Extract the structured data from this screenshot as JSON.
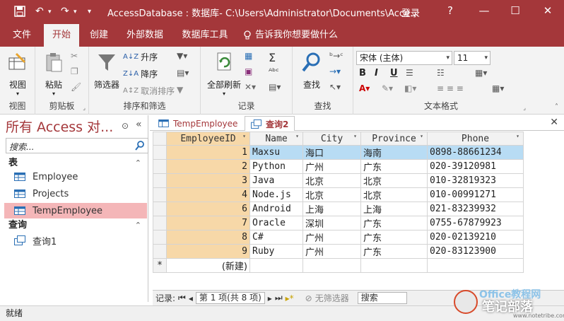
{
  "titlebar": {
    "title": "AccessDatabase : 数据库- C:\\Users\\Administrator\\Documents\\Acce...",
    "login": "登录",
    "help": "?",
    "minimize": "—",
    "restore": "☐",
    "close": "✕"
  },
  "ribbon_tabs": [
    {
      "label": "文件"
    },
    {
      "label": "开始"
    },
    {
      "label": "创建"
    },
    {
      "label": "外部数据"
    },
    {
      "label": "数据库工具"
    },
    {
      "label": "告诉我你想要做什么"
    }
  ],
  "ribbon": {
    "view": {
      "button": "视图",
      "group": "视图"
    },
    "clipboard": {
      "paste": "粘贴",
      "group": "剪贴板"
    },
    "sort_filter": {
      "filter": "筛选器",
      "ascending": "升序",
      "descending": "降序",
      "remove_sort": "取消排序",
      "group": "排序和筛选"
    },
    "records": {
      "refresh_all": "全部刷新",
      "group": "记录"
    },
    "find": {
      "find": "查找",
      "group": "查找"
    },
    "text_format": {
      "font": "宋体 (主体)",
      "size": "11",
      "bold": "B",
      "italic": "I",
      "underline": "U",
      "group": "文本格式"
    }
  },
  "nav_pane": {
    "title": "所有 Access 对...",
    "search_placeholder": "搜索...",
    "tables_header": "表",
    "tables": [
      {
        "label": "Employee"
      },
      {
        "label": "Projects"
      },
      {
        "label": "TempEmployee"
      }
    ],
    "queries_header": "查询",
    "queries": [
      {
        "label": "查询1"
      }
    ]
  },
  "doc_tabs": [
    {
      "label": "TempEmployee"
    },
    {
      "label": "查询2"
    }
  ],
  "datasheet": {
    "columns": [
      "EmployeeID",
      "Name",
      "City",
      "Province",
      "Phone"
    ],
    "rows": [
      {
        "id": "1",
        "name": "Maxsu",
        "city": "海口",
        "province": "海南",
        "phone": "0898-88661234"
      },
      {
        "id": "2",
        "name": "Python",
        "city": "广州",
        "province": "广东",
        "phone": "020-39120981"
      },
      {
        "id": "3",
        "name": "Java",
        "city": "北京",
        "province": "北京",
        "phone": "010-32819323"
      },
      {
        "id": "4",
        "name": "Node.js",
        "city": "北京",
        "province": "北京",
        "phone": "010-00991271"
      },
      {
        "id": "6",
        "name": "Android",
        "city": "上海",
        "province": "上海",
        "phone": "021-83239932"
      },
      {
        "id": "7",
        "name": "Oracle",
        "city": "深圳",
        "province": "广东",
        "phone": "0755-67879923"
      },
      {
        "id": "8",
        "name": "C#",
        "city": "广州",
        "province": "广东",
        "phone": "020-02139210"
      },
      {
        "id": "9",
        "name": "Ruby",
        "city": "广州",
        "province": "广东",
        "phone": "020-83123900"
      }
    ],
    "new_row_marker": "*",
    "new_row_label": "(新建)"
  },
  "record_nav": {
    "label": "记录:",
    "position": "第 1 项(共 8 项)",
    "no_filter": "无筛选器",
    "search": "搜索"
  },
  "status": "就绪",
  "watermark": {
    "line1": "Office教程网",
    "line2": "笔记部落",
    "line3": "www.notetribe.com"
  },
  "colors": {
    "accent": "#a4373a",
    "selected_nav": "#f4b6b8",
    "selected_column": "#f7d8a8",
    "current_row": "#b8dcf4"
  }
}
